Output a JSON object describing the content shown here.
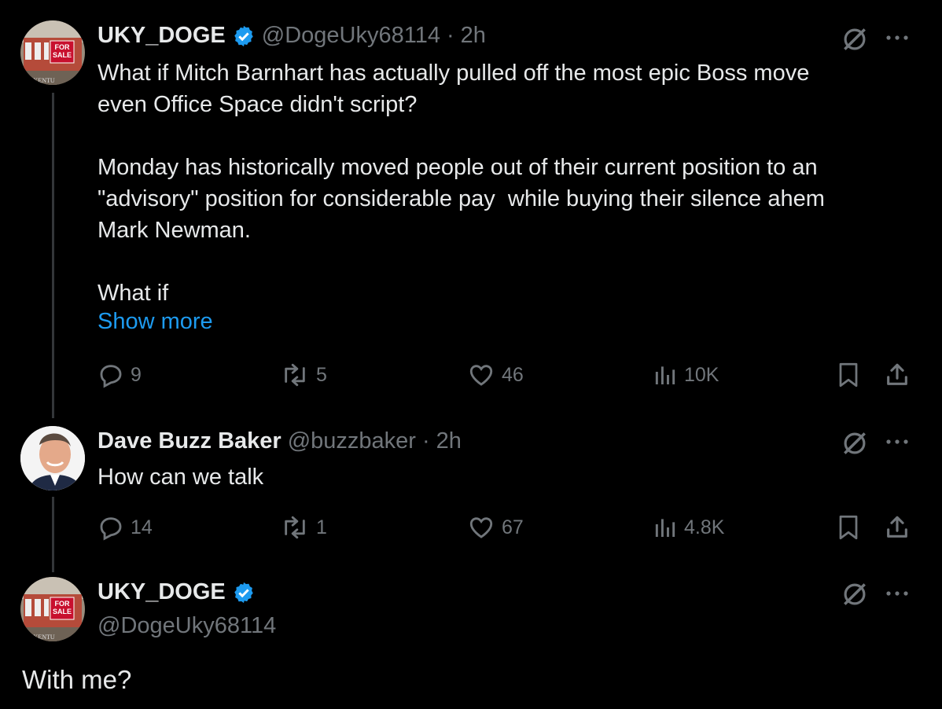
{
  "posts": [
    {
      "name": "UKY_DOGE",
      "handle": "@DogeUky68114",
      "time_sep": "·",
      "time": "2h",
      "verified": true,
      "text": "What if Mitch Barnhart has actually pulled off the most epic Boss move\neven Office Space didn't script?\n\nMonday has historically moved people out of their current position to an\n\"advisory\" position for considerable pay  while buying their silence ahem\nMark Newman.\n\nWhat if",
      "show_more": "Show more",
      "replies": "9",
      "reposts": "5",
      "likes": "46",
      "views": "10K"
    },
    {
      "name": "Dave Buzz Baker",
      "handle": "@buzzbaker",
      "time_sep": "·",
      "time": "2h",
      "verified": false,
      "text": "How can we talk",
      "replies": "14",
      "reposts": "1",
      "likes": "67",
      "views": "4.8K"
    },
    {
      "name": "UKY_DOGE",
      "handle": "@DogeUky68114",
      "verified": true,
      "text": "With me?"
    }
  ],
  "avatar_sign": {
    "line1": "FOR",
    "line2": "SALE",
    "bottom": "OF KENTU"
  },
  "colors": {
    "accent": "#1d9bf0",
    "muted": "#71767b",
    "text": "#e7e9ea",
    "sign": "#c8102e"
  }
}
